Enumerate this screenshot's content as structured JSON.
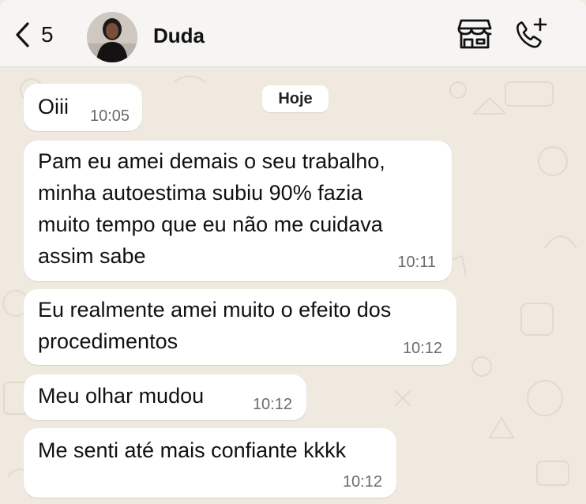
{
  "header": {
    "back_count": "5",
    "contact_name": "Duda",
    "icons": [
      "chevron-left-icon",
      "store-icon",
      "phone-plus-icon"
    ]
  },
  "chat": {
    "date_label": "Hoje",
    "messages": [
      {
        "text": "Oiii",
        "time": "10:05"
      },
      {
        "text": "Pam eu amei demais o seu trabalho,\nminha autoestima subiu 90% fazia\nmuito tempo que eu não me cuidava\nassim sabe",
        "time": "10:11"
      },
      {
        "text": "Eu realmente amei muito o efeito dos\nprocedimentos",
        "time": "10:12"
      },
      {
        "text": "Meu olhar mudou",
        "time": "10:12"
      },
      {
        "text": "Me senti até mais confiante kkkk",
        "time": "10:12"
      }
    ]
  },
  "colors": {
    "chat_background": "#efe9df",
    "bubble_incoming": "#ffffff",
    "header_background": "#f6f5f3",
    "timestamp": "#6b6b6b"
  }
}
